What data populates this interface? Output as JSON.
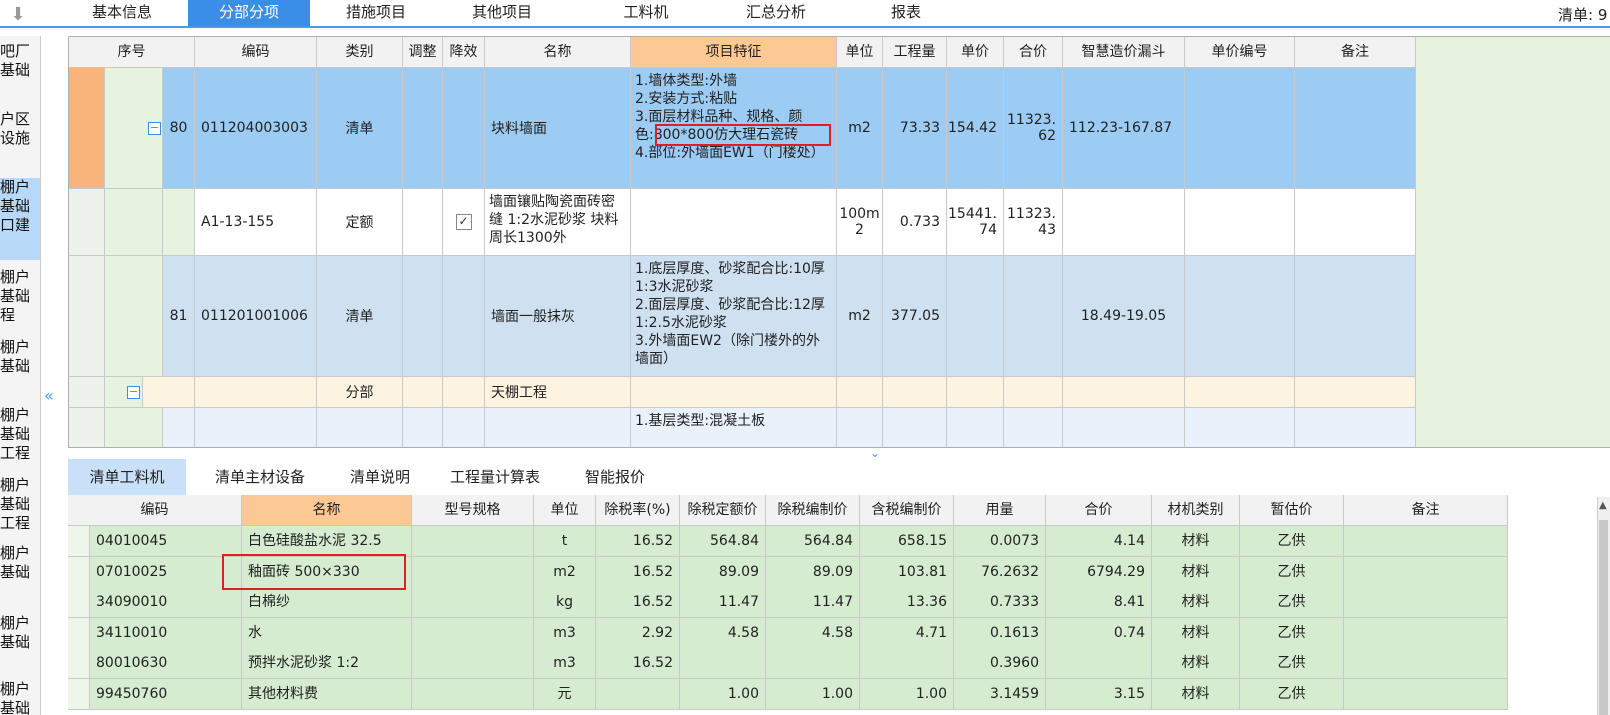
{
  "top_tabs": [
    "基本信息",
    "分部分项",
    "措施项目",
    "其他项目",
    "工料机",
    "汇总分析",
    "报表"
  ],
  "top_right_label": "清单: 9",
  "sidebar_items": [
    "吧厂\n基础",
    "户区\n设施",
    "棚户\n基础\n口建",
    "棚户\n基础\n程",
    "棚户\n基础",
    "棚户\n基础\n工程",
    "棚户\n基础\n工程",
    "棚户\n基础",
    "棚户\n基础",
    "棚户\n基础"
  ],
  "upper_table": {
    "headers": [
      "序号",
      "编码",
      "类别",
      "调整",
      "降效",
      "名称",
      "项目特征",
      "单位",
      "工程量",
      "单价",
      "合价",
      "智慧造价漏斗",
      "单价编号",
      "备注"
    ],
    "rows": [
      {
        "seq": "80",
        "code": "011204003003",
        "type": "清单",
        "name": "块料墙面",
        "features": "1.墙体类型:外墙\n2.安装方式:粘贴\n3.面层材料品种、规格、颜色:800*800仿大理石瓷砖\n4.部位:外墙面EW1（门楼处）",
        "unit": "m2",
        "qty": "73.33",
        "price": "154.42",
        "total": "11323.62",
        "smart": "112.23-167.87"
      },
      {
        "seq": "",
        "code": "A1-13-155",
        "type": "定额",
        "name": "墙面镶贴陶瓷面砖密缝 1:2水泥砂浆 块料周长1300外",
        "features": "",
        "unit": "100m2",
        "qty": "0.733",
        "price": "15441.74",
        "total": "11323.43",
        "smart": ""
      },
      {
        "seq": "81",
        "code": "011201001006",
        "type": "清单",
        "name": "墙面一般抹灰",
        "features": "1.底层厚度、砂浆配合比:10厚1:3水泥砂浆\n2.面层厚度、砂浆配合比:12厚1:2.5水泥砂浆\n3.外墙面EW2（除门楼外的外墙面）",
        "unit": "m2",
        "qty": "377.05",
        "price": "",
        "total": "",
        "smart": "18.49-19.05"
      },
      {
        "seq": "",
        "code": "",
        "type": "分部",
        "name": "天棚工程",
        "features": "",
        "unit": "",
        "qty": "",
        "price": "",
        "total": "",
        "smart": ""
      },
      {
        "seq": "",
        "code": "",
        "type": "",
        "name": "",
        "features": "1.基层类型:混凝土板",
        "unit": "",
        "qty": "",
        "price": "",
        "total": "",
        "smart": ""
      }
    ]
  },
  "bottom_tabs": [
    "清单工料机",
    "清单主材设备",
    "清单说明",
    "工程量计算表",
    "智能报价"
  ],
  "lower_table": {
    "headers": [
      "编码",
      "名称",
      "型号规格",
      "单位",
      "除税率(%)",
      "除税定额价",
      "除税编制价",
      "含税编制价",
      "用量",
      "合价",
      "材机类别",
      "暂估价",
      "备注"
    ],
    "rows": [
      [
        "04010045",
        "白色硅酸盐水泥 32.5",
        "",
        "t",
        "16.52",
        "564.84",
        "564.84",
        "658.15",
        "0.0073",
        "4.14",
        "材料",
        "乙供",
        ""
      ],
      [
        "07010025",
        "釉面砖 500×330",
        "",
        "m2",
        "16.52",
        "89.09",
        "89.09",
        "103.81",
        "76.2632",
        "6794.29",
        "材料",
        "乙供",
        ""
      ],
      [
        "34090010",
        "白棉纱",
        "",
        "kg",
        "16.52",
        "11.47",
        "11.47",
        "13.36",
        "0.7333",
        "8.41",
        "材料",
        "乙供",
        ""
      ],
      [
        "34110010",
        "水",
        "",
        "m3",
        "2.92",
        "4.58",
        "4.58",
        "4.71",
        "0.1613",
        "0.74",
        "材料",
        "乙供",
        ""
      ],
      [
        "80010630",
        "预拌水泥砂浆 1:2",
        "",
        "m3",
        "16.52",
        "",
        "",
        "",
        "0.3960",
        "",
        "材料",
        "乙供",
        ""
      ],
      [
        "99450760",
        "其他材料费",
        "",
        "元",
        "",
        "1.00",
        "1.00",
        "1.00",
        "3.1459",
        "3.15",
        "材料",
        "乙供",
        ""
      ]
    ]
  },
  "colors": {
    "accent": "#3a8ee6",
    "row_selected": "#9ccbf3",
    "row_light": "#cfe1f1",
    "row_section": "#fcf4e0",
    "grid_green": "#d5ecd0",
    "header_highlight": "#fcc994",
    "highlight_box": "#e02020"
  }
}
